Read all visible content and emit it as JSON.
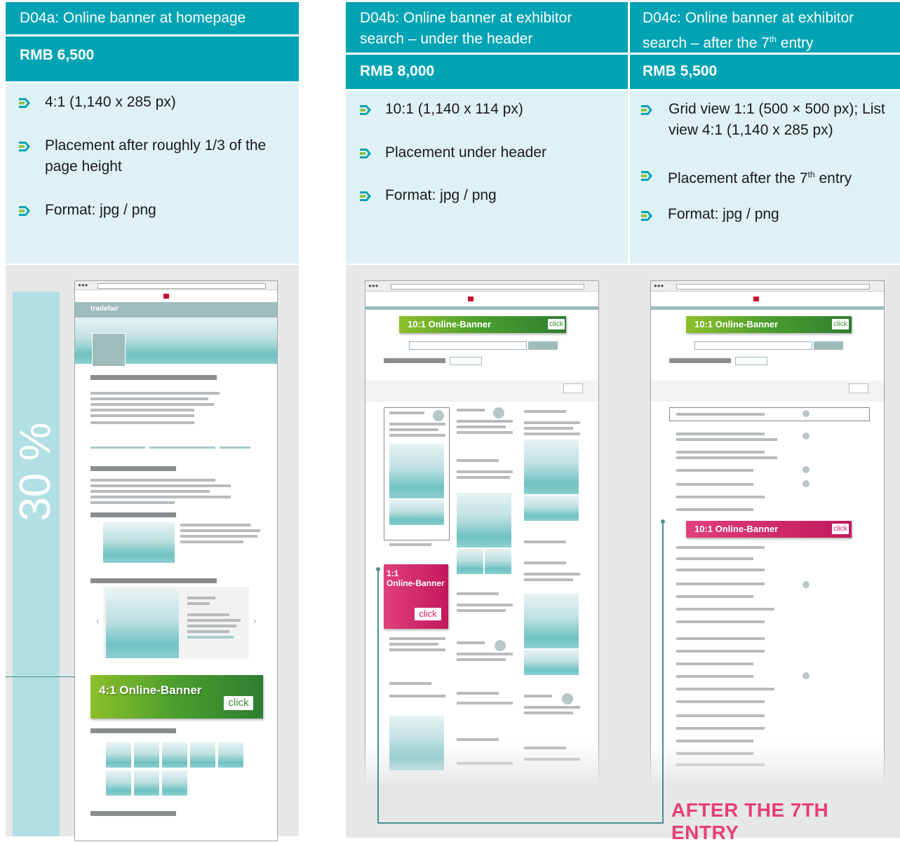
{
  "columns": [
    {
      "title": "D04a: Online banner at homepage",
      "price": "RMB 6,500",
      "bullets": [
        "4:1 (1,140 x 285 px)",
        "Placement after roughly 1/3 of the page height",
        "Format: jpg / png"
      ]
    },
    {
      "title": "D04b: Online banner at exhibitor search – under the header",
      "price": "RMB 8,000",
      "bullets": [
        "10:1 (1,140 x 114 px)",
        "Placement under header",
        "Format: jpg / png"
      ]
    },
    {
      "title_pre": "D04c: Online banner at exhibitor search – after the 7",
      "title_sup": "th",
      "title_post": " entry",
      "price": "RMB 5,500",
      "bullet1": "Grid view 1:1 (500 × 500 px); List view 4:1 (1,140 x 285 px)",
      "bullet2_pre": "Placement after the 7",
      "bullet2_sup": "th",
      "bullet2_post": " entry",
      "bullet3": "Format: jpg / png"
    }
  ],
  "mockups": {
    "percent_label": "30 %",
    "homepage_logo": "tradefair",
    "banner_4_1": "4:1 Online-Banner",
    "banner_10_1": "10:1 Online-Banner",
    "banner_1_1_line1": "1:1",
    "banner_1_1_line2": "Online-Banner",
    "click_label": "click",
    "after_entry_label": "AFTER THE 7TH ENTRY"
  },
  "colors": {
    "teal": "#00a3b4",
    "light_teal": "#dff1f4",
    "pink": "#e83e78",
    "green": "#4a9e2d"
  },
  "icons": [
    "arrow-bullet-icon"
  ]
}
